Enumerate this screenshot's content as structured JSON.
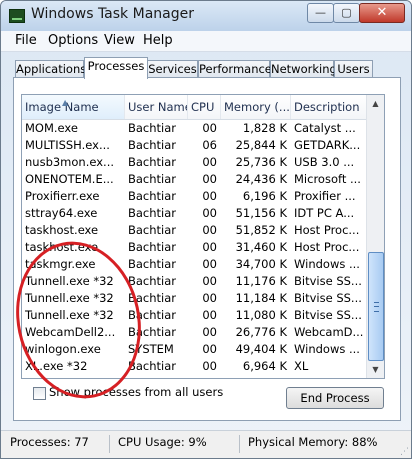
{
  "window": {
    "title": "Windows Task Manager",
    "minimize": "—",
    "maximize": "▢",
    "close": "✕"
  },
  "menu": [
    "File",
    "Options",
    "View",
    "Help"
  ],
  "tabs": [
    "Applications",
    "Processes",
    "Services",
    "Performance",
    "Networking",
    "Users"
  ],
  "active_tab": "Processes",
  "columns": [
    "Image Name",
    "User Name",
    "CPU",
    "Memory (...",
    "Description"
  ],
  "rows": [
    {
      "image": "MOM.exe",
      "user": "Bachtiar",
      "cpu": "00",
      "memory": "1,828 K",
      "desc": "Catalyst ..."
    },
    {
      "image": "MULTISSH.ex...",
      "user": "Bachtiar",
      "cpu": "06",
      "memory": "25,844 K",
      "desc": "GETDARK..."
    },
    {
      "image": "nusb3mon.ex...",
      "user": "Bachtiar",
      "cpu": "00",
      "memory": "25,736 K",
      "desc": "USB 3.0 ..."
    },
    {
      "image": "ONENOTEM.E...",
      "user": "Bachtiar",
      "cpu": "00",
      "memory": "24,436 K",
      "desc": "Microsoft ..."
    },
    {
      "image": "Proxifierr.exe",
      "user": "Bachtiar",
      "cpu": "00",
      "memory": "6,196 K",
      "desc": "Proxifier ..."
    },
    {
      "image": "sttray64.exe",
      "user": "Bachtiar",
      "cpu": "00",
      "memory": "51,156 K",
      "desc": "IDT PC A..."
    },
    {
      "image": "taskhost.exe",
      "user": "Bachtiar",
      "cpu": "00",
      "memory": "51,852 K",
      "desc": "Host Proc..."
    },
    {
      "image": "taskhost.exe",
      "user": "Bachtiar",
      "cpu": "00",
      "memory": "31,460 K",
      "desc": "Host Proc..."
    },
    {
      "image": "taskmgr.exe",
      "user": "Bachtiar",
      "cpu": "00",
      "memory": "34,700 K",
      "desc": "Windows ..."
    },
    {
      "image": "Tunnell.exe *32",
      "user": "Bachtiar",
      "cpu": "00",
      "memory": "11,176 K",
      "desc": "Bitvise SS..."
    },
    {
      "image": "Tunnell.exe *32",
      "user": "Bachtiar",
      "cpu": "00",
      "memory": "11,184 K",
      "desc": "Bitvise SS..."
    },
    {
      "image": "Tunnell.exe *32",
      "user": "Bachtiar",
      "cpu": "00",
      "memory": "11,080 K",
      "desc": "Bitvise SS..."
    },
    {
      "image": "WebcamDell2...",
      "user": "Bachtiar",
      "cpu": "00",
      "memory": "26,776 K",
      "desc": "WebcamD..."
    },
    {
      "image": "winlogon.exe",
      "user": "SYSTEM",
      "cpu": "00",
      "memory": "49,404 K",
      "desc": "Windows ..."
    },
    {
      "image": "XL.exe *32",
      "user": "Bachtiar",
      "cpu": "00",
      "memory": "6,964 K",
      "desc": "XL"
    }
  ],
  "show_all_label": "Show processes from all users",
  "end_process_label": "End Process",
  "status": {
    "processes": "Processes: 77",
    "cpu": "CPU Usage: 9%",
    "memory": "Physical Memory: 88%"
  },
  "annotation_color": "#d62024",
  "selected_tab_color": "#ffffff"
}
